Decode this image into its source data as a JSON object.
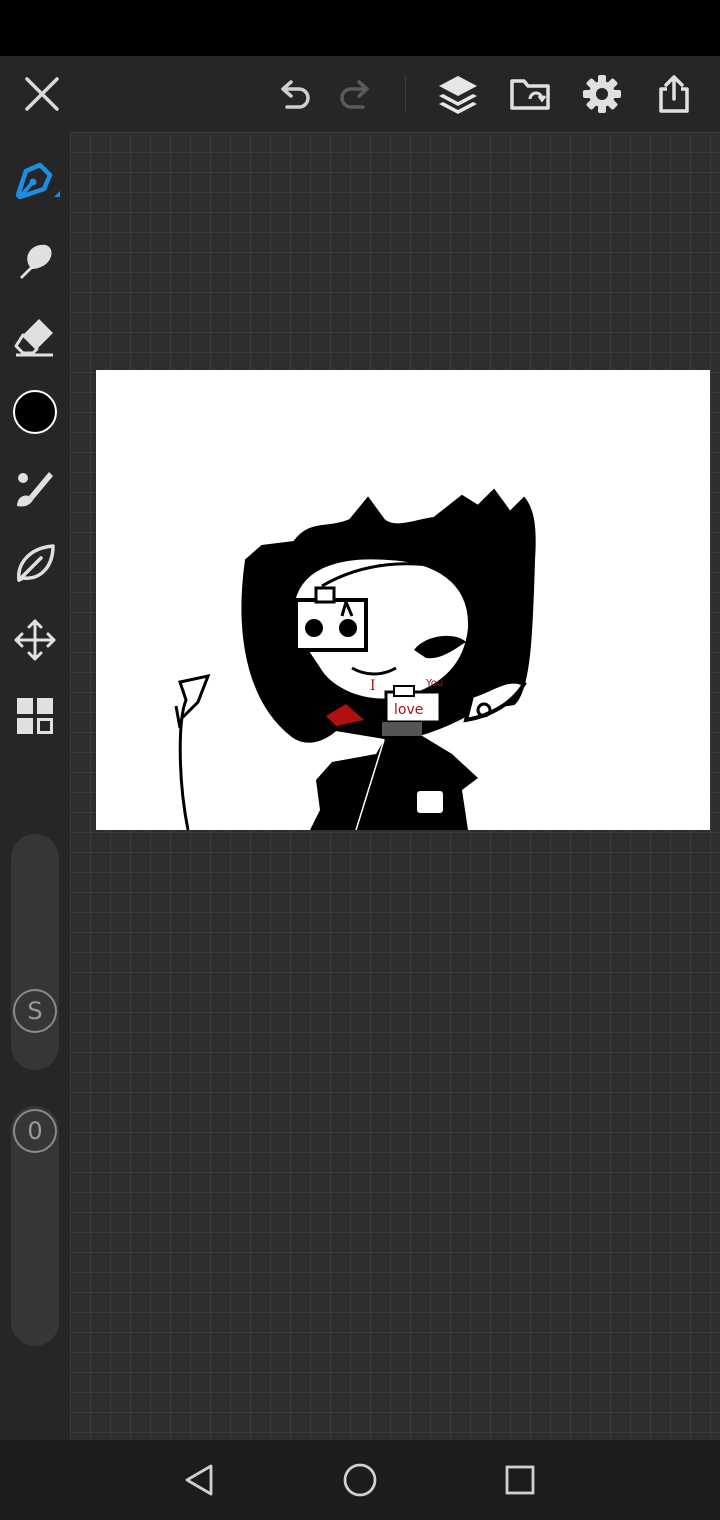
{
  "status_bar": {},
  "toolbar": {
    "left": [
      {
        "name": "close-icon"
      }
    ],
    "history": [
      {
        "name": "undo-icon"
      },
      {
        "name": "redo-icon",
        "disabled": true
      }
    ],
    "right": [
      {
        "name": "layers-icon"
      },
      {
        "name": "file-import-icon"
      },
      {
        "name": "settings-gear-icon"
      },
      {
        "name": "share-export-icon"
      }
    ]
  },
  "tools": {
    "items": [
      "pen-tool-icon",
      "smudge-tool-icon",
      "eraser-tool-icon",
      "color-picker",
      "brush-settings-icon",
      "liquify-tool-icon",
      "transform-move-icon",
      "gallery-grid-icon"
    ],
    "active": "pen-tool-icon",
    "active_color": "#1a8fe3",
    "current_color": "#000000"
  },
  "sliders": {
    "size_label": "S",
    "opacity_label": "0"
  },
  "canvas": {
    "drawing_text": {
      "i": "I",
      "you": "You",
      "love": "love"
    },
    "accent_red": "#b01010"
  },
  "nav": [
    "back-nav-icon",
    "home-nav-icon",
    "recents-nav-icon"
  ]
}
